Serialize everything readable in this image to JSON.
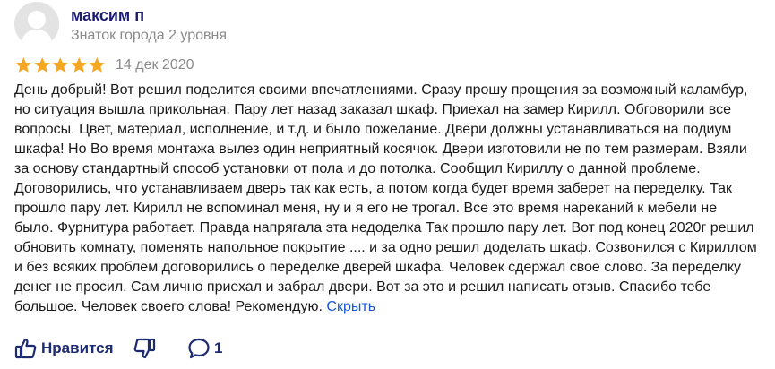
{
  "author": {
    "name": "максим п",
    "rank": "Знаток города 2 уровня"
  },
  "review": {
    "rating": 5,
    "rating_max": 5,
    "date": "14 дек 2020",
    "text": "День добрый! Вот решил поделится своими впечатлениями. Сразу прошу прощения за возможный каламбур, но ситуация вышла прикольная. Пару лет назад заказал шкаф. Приехал на замер Кирилл. Обговорили все вопросы. Цвет, материал, исполнение, и т.д. и было пожелание. Двери должны устанавливаться на подиум шкафа! Но Во время монтажа вылез один неприятный косячок. Двери изготовили не по тем размерам. Взяли за основу стандартный способ установки от пола и до потолка. Сообщил Кириллу о данной проблеме. Договорились, что устанавливаем дверь так как есть, а потом когда будет время заберет на переделку. Так прошло пару лет. Кирилл не вспоминал меня, ну и я его не трогал. Все это время нареканий к мебели не было. Фурнитура работает. Правда напрягала эта недоделка Так прошло пару лет. Вот под конец 2020г решил обновить комнату, поменять напольное покрытие .... и за одно решил доделать шкаф. Созвонился с Кириллом и без всяких проблем договорились о переделке дверей шкафа. Человек сдержал свое слово. За переделку денег не просил. Сам лично приехал и забрал двери. Вот за это и решил написать отзыв. Спасибо тебе большое. Человек своего слова! Рекомендую.",
    "hide_label": "Скрыть"
  },
  "actions": {
    "like_label": "Нравится",
    "comments_count": "1"
  },
  "colors": {
    "star": "#f5a623",
    "author_name": "#1c1c72",
    "secondary_text": "#8a8a8a",
    "link": "#1a55d8",
    "action": "#1c2a72"
  }
}
